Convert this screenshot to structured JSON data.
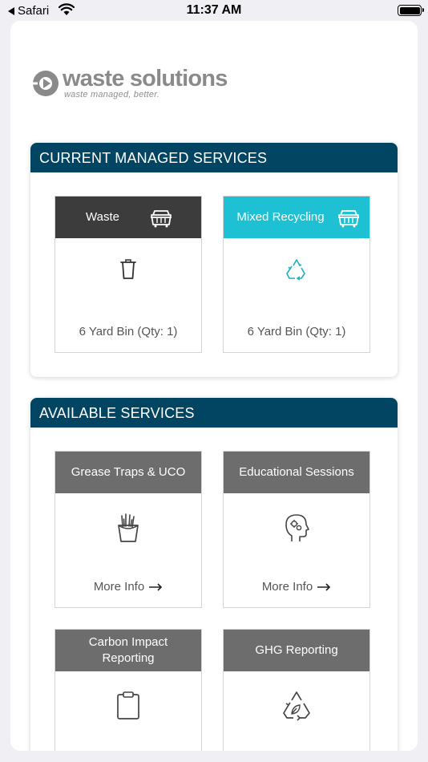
{
  "status_bar": {
    "back_label": "Safari",
    "time": "11:37 AM"
  },
  "logo": {
    "name": "waste solutions",
    "tagline": "waste managed, better."
  },
  "current_services": {
    "title": "CURRENT MANAGED SERVICES",
    "items": [
      {
        "name": "Waste",
        "detail": "6 Yard Bin (Qty: 1)",
        "icon": "trash-can-icon",
        "color": "#3c3c3c"
      },
      {
        "name": "Mixed Recycling",
        "detail": "6 Yard Bin (Qty: 1)",
        "icon": "recycle-icon",
        "color": "#1ec0d3"
      }
    ]
  },
  "available_services": {
    "title": "AVAILABLE SERVICES",
    "items": [
      {
        "name": "Grease Traps & UCO",
        "link": "More Info",
        "icon": "fries-icon"
      },
      {
        "name": "Educational Sessions",
        "link": "More Info",
        "icon": "head-gears-icon"
      },
      {
        "name": "Carbon Impact Reporting",
        "icon": "clipboard-icon"
      },
      {
        "name": "GHG Reporting",
        "icon": "recycle-leaf-icon"
      }
    ]
  },
  "colors": {
    "header": "#014563",
    "accent": "#1ec0d3",
    "card_grey": "#6d6d6d"
  }
}
